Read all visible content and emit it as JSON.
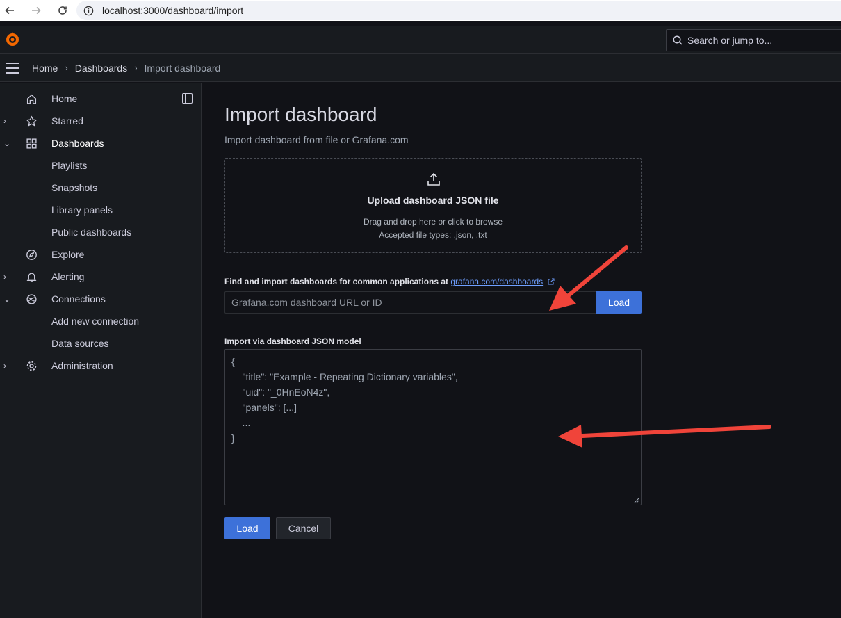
{
  "browser": {
    "url": "localhost:3000/dashboard/import"
  },
  "topbar": {
    "search_placeholder": "Search or jump to..."
  },
  "breadcrumb": {
    "items": [
      "Home",
      "Dashboards",
      "Import dashboard"
    ],
    "separator": "›"
  },
  "sidebar": {
    "items": [
      {
        "label": "Home",
        "icon": "home-icon"
      },
      {
        "label": "Starred",
        "icon": "star-icon"
      },
      {
        "label": "Dashboards",
        "icon": "apps-icon"
      },
      {
        "label": "Playlists"
      },
      {
        "label": "Snapshots"
      },
      {
        "label": "Library panels"
      },
      {
        "label": "Public dashboards"
      },
      {
        "label": "Explore",
        "icon": "compass-icon"
      },
      {
        "label": "Alerting",
        "icon": "bell-icon"
      },
      {
        "label": "Connections",
        "icon": "connections-icon"
      },
      {
        "label": "Add new connection"
      },
      {
        "label": "Data sources"
      },
      {
        "label": "Administration",
        "icon": "cog-icon"
      }
    ],
    "chevrons": {
      "collapsed": "›",
      "expanded": "⌄"
    }
  },
  "main": {
    "title": "Import dashboard",
    "subtitle": "Import dashboard from file or Grafana.com",
    "upload": {
      "title": "Upload dashboard JSON file",
      "line1": "Drag and drop here or click to browse",
      "line2": "Accepted file types: .json, .txt"
    },
    "gcom": {
      "label": "Find and import dashboards for common applications at",
      "link": "grafana.com/dashboards",
      "placeholder": "Grafana.com dashboard URL or ID",
      "button": "Load"
    },
    "json_model": {
      "label": "Import via dashboard JSON model",
      "placeholder_lines": [
        "{",
        "    \"title\": \"Example - Repeating Dictionary variables\",",
        "    \"uid\": \"_0HnEoN4z\",",
        "    \"panels\": [...]",
        "    ...",
        "}"
      ]
    },
    "actions": {
      "load": "Load",
      "cancel": "Cancel"
    }
  },
  "colors": {
    "primary": "#3d71d9",
    "link": "#6e9fff",
    "annotation_arrow": "#f0443a",
    "logo": "#f46800"
  }
}
